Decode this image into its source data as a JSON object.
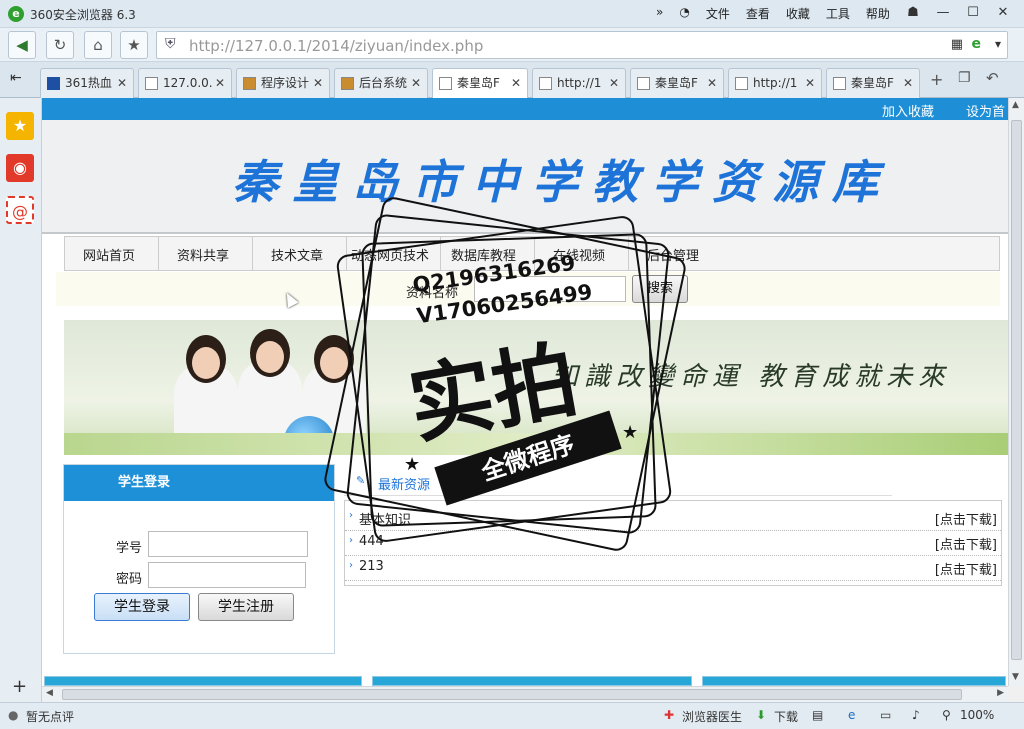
{
  "browser": {
    "title": "360安全浏览器 6.3",
    "menu": [
      "文件",
      "查看",
      "收藏",
      "工具",
      "帮助"
    ],
    "url_host": "http://127.0.0.1",
    "url_path": "/2014/ziyuan/index.php",
    "tabs": [
      "361热血",
      "127.0.0.",
      "程序设计",
      "后台系统",
      "秦皇岛F",
      "http://1",
      "秦皇岛F",
      "http://1",
      "秦皇岛F"
    ],
    "active_tab_index": 4,
    "status_left": "暂无点评",
    "status_items": [
      "浏览器医生",
      "下载",
      "100%"
    ]
  },
  "site": {
    "top_links": [
      "加入收藏",
      "设为首"
    ],
    "title": "秦皇岛市中学教学资源库",
    "nav": [
      "网站首页",
      "资料共享",
      "技术文章",
      "动态网页技术",
      "数据库教程",
      "在线视频",
      "后台管理"
    ],
    "search_label": "资料名称",
    "search_button": "搜索",
    "banner_slogan": "知識改變命運 教育成就未來",
    "login": {
      "title": "学生登录",
      "id_label": "学号",
      "pwd_label": "密码",
      "login_button": "学生登录",
      "register_button": "学生注册"
    },
    "resources_title": "最新资源",
    "resources": [
      {
        "name": "基本知识",
        "action": "[点击下载]"
      },
      {
        "name": "444",
        "action": "[点击下载]"
      },
      {
        "name": "213",
        "action": "[点击下载]"
      }
    ]
  },
  "watermark": {
    "line1": "Q2196316269",
    "line2": "V17060256499",
    "big": "实拍",
    "ribbon": "全微程序"
  }
}
